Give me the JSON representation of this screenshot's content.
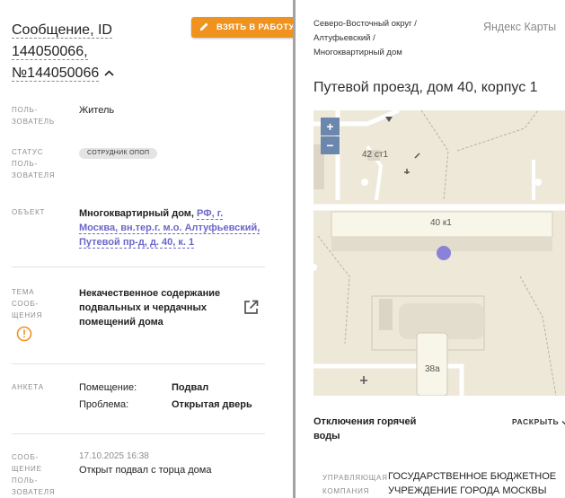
{
  "header": {
    "title_line1": "Сообщение, ID",
    "title_line2": "144050066,",
    "title_line3": "№144050066",
    "take_button": "ВЗЯТЬ В РАБОТУ"
  },
  "fields": {
    "user_label_1": "ПОЛЬ-",
    "user_label_2": "ЗОВАТЕЛЬ",
    "user_value": "Житель",
    "status_label_1": "СТАТУС",
    "status_label_2": "ПОЛЬ-",
    "status_label_3": "ЗОВАТЕЛЯ",
    "status_badge": "СОТРУДНИК ОПОП",
    "object_label": "ОБЪЕКТ",
    "object_prefix": "Многоквартирный дом, ",
    "object_link": "РФ, г. Москва, вн.тер.г. м.о. Алтуфьевский, Путевой пр-д, д. 40, к. 1",
    "topic_label_1": "ТЕМА",
    "topic_label_2": "СООБ-",
    "topic_label_3": "ЩЕНИЯ",
    "topic_value": "Некачественное содержание подвальных и чердачных помещений дома",
    "anketa_label": "АНКЕТА",
    "room_key": "Помещение:",
    "room_value": "Подвал",
    "problem_key": "Проблема:",
    "problem_value": "Открытая дверь",
    "msg_label_1": "СООБ-",
    "msg_label_2": "ЩЕНИЕ",
    "msg_label_3": "ПОЛЬ-",
    "msg_label_4": "ЗОВАТЕЛЯ",
    "msg_date": "17.10.2025 16:38",
    "msg_text": "Открыт подвал с торца дома"
  },
  "right": {
    "breadcrumb_1": "Северо-Восточный округ /",
    "breadcrumb_2": "Алтуфьевский /",
    "breadcrumb_3": "Многоквартирный дом",
    "yandex_maps": "Яндекс Карты",
    "address": "Путевой проезд, дом 40, корпус 1",
    "map": {
      "zoom_in": "+",
      "zoom_out": "−",
      "building_1": "42 ст1",
      "building_2": "40 к1",
      "building_3": "38а",
      "marker_color": "#8a82d8"
    },
    "hot_water": "Отключения горячей воды",
    "expand": "РАСКРЫТЬ",
    "uk_label_1": "УПРАВЛЯЮЩАЯ",
    "uk_label_2": "КОМПАНИЯ",
    "uk_value": "ГОСУДАРСТВЕННОЕ БЮДЖЕТНОЕ УЧРЕЖДЕНИЕ ГОРОДА МОСКВЫ"
  },
  "colors": {
    "accent": "#f0921e",
    "link": "#6b67c9",
    "zoom": "#6b87ad"
  },
  "icons": [
    "pencil-icon",
    "chevron-up-icon",
    "open-external-icon",
    "warning-icon",
    "chevron-down-icon"
  ]
}
